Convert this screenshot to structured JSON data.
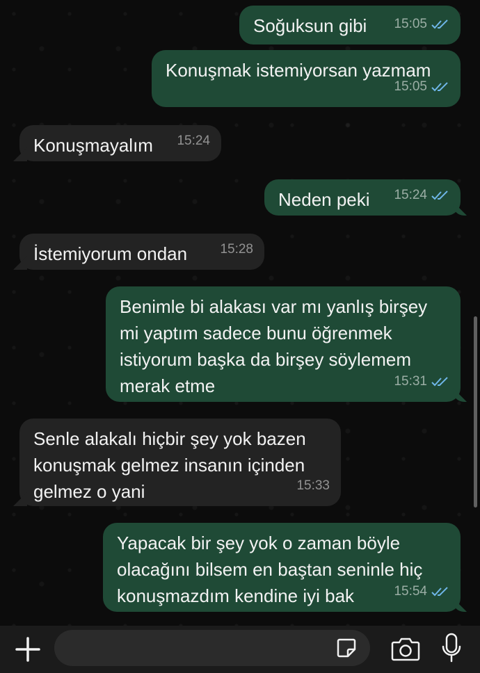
{
  "messages": [
    {
      "direction": "out",
      "text": "Soğuksun gibi",
      "time": "15:05",
      "status": "read"
    },
    {
      "direction": "out",
      "text": "Konuşmak istemiyorsan yazmam",
      "time": "15:05",
      "status": "read"
    },
    {
      "direction": "in",
      "text": "Konuşmayalım",
      "time": "15:24"
    },
    {
      "direction": "out",
      "text": "Neden peki",
      "time": "15:24",
      "status": "read"
    },
    {
      "direction": "in",
      "text": "İstemiyorum ondan",
      "time": "15:28"
    },
    {
      "direction": "out",
      "text": "Benimle bi alakası var mı yanlış birşey\nmi yaptım sadece bunu öğrenmek\nistiyorum başka da birşey söylemem\nmerak etme",
      "time": "15:31",
      "status": "read"
    },
    {
      "direction": "in",
      "text": "Senle alakalı hiçbir şey yok bazen\nkonuşmak gelmez insanın içinden\ngelmez o yani",
      "time": "15:33"
    },
    {
      "direction": "out",
      "text": "Yapacak bir şey yok o zaman böyle\nolacağını bilsem en baştan seninle hiç\nkonuşmazdım kendine iyi bak",
      "time": "15:54",
      "status": "read"
    }
  ],
  "composer": {
    "placeholder": "",
    "value": ""
  },
  "icons": {
    "attach": "plus-icon",
    "sticker": "sticker-icon",
    "camera": "camera-icon",
    "mic": "microphone-icon",
    "read_receipt": "double-check-icon"
  },
  "colors": {
    "outgoing_bubble": "#1f4a36",
    "incoming_bubble": "#232323",
    "read_tick": "#6fb6e8",
    "background": "#0b0b0b"
  }
}
